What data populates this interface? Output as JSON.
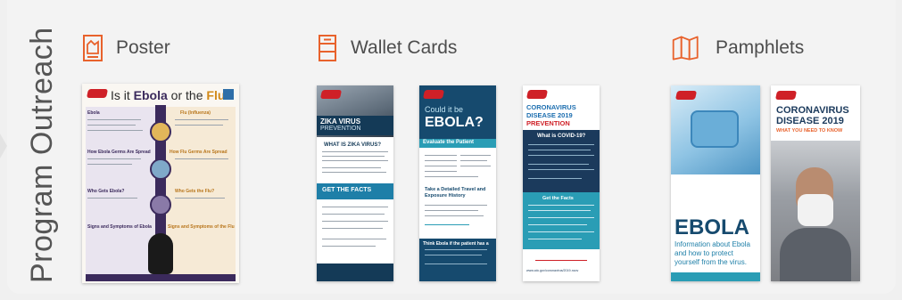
{
  "section": {
    "title": "Program Outreach"
  },
  "categories": [
    {
      "label": "Poster",
      "icon": "poster-icon"
    },
    {
      "label": "Wallet Cards",
      "icon": "wallet-cards-icon"
    },
    {
      "label": "Pamphlets",
      "icon": "pamphlets-icon"
    }
  ],
  "colors": {
    "accent": "#e8622c",
    "text": "#4d4d4d",
    "navy": "#1b3a5c",
    "teal": "#2a9db5",
    "red": "#cf2027",
    "purple": "#3b2a5c"
  },
  "poster": {
    "title_pre": "Is it ",
    "title_ebola": "Ebola",
    "title_mid": " or the ",
    "title_flu": "Flu",
    "title_q": "?",
    "left": [
      "Ebola",
      "How Ebola Germs Are Spread",
      "Who Gets Ebola?",
      "Signs and Symptoms of Ebola"
    ],
    "right": [
      "Flu (Influenza)",
      "How Flu Germs Are Spread",
      "Who Gets the Flu?",
      "Signs and Symptoms of the Flu"
    ]
  },
  "wallet_zika": {
    "head1": "ZIKA VIRUS",
    "head2": "PREVENTION",
    "q": "WHAT IS ZIKA VIRUS?",
    "facts": "GET THE FACTS"
  },
  "wallet_ebola": {
    "head1": "Could it be",
    "head2": "EBOLA?",
    "sub1": "Evaluate the Patient",
    "sub2": "Take a Detailed Travel and Exposure History",
    "sub3": "Think Ebola if the patient has a"
  },
  "wallet_covid": {
    "head1": "CORONAVIRUS",
    "head2": "DISEASE 2019",
    "head3": "PREVENTION",
    "q": "What is COVID-19?",
    "facts": "Get the Facts",
    "url": "www.cdc.gov/coronavirus/2019-ncov"
  },
  "pamphlet_ebola": {
    "title": "EBOLA",
    "desc1": "Information about Ebola",
    "desc2": "and how to protect",
    "desc3": "yourself from the virus."
  },
  "pamphlet_covid": {
    "title1": "CORONAVIRUS",
    "title2": "DISEASE 2019",
    "sub": "WHAT YOU NEED TO KNOW"
  }
}
